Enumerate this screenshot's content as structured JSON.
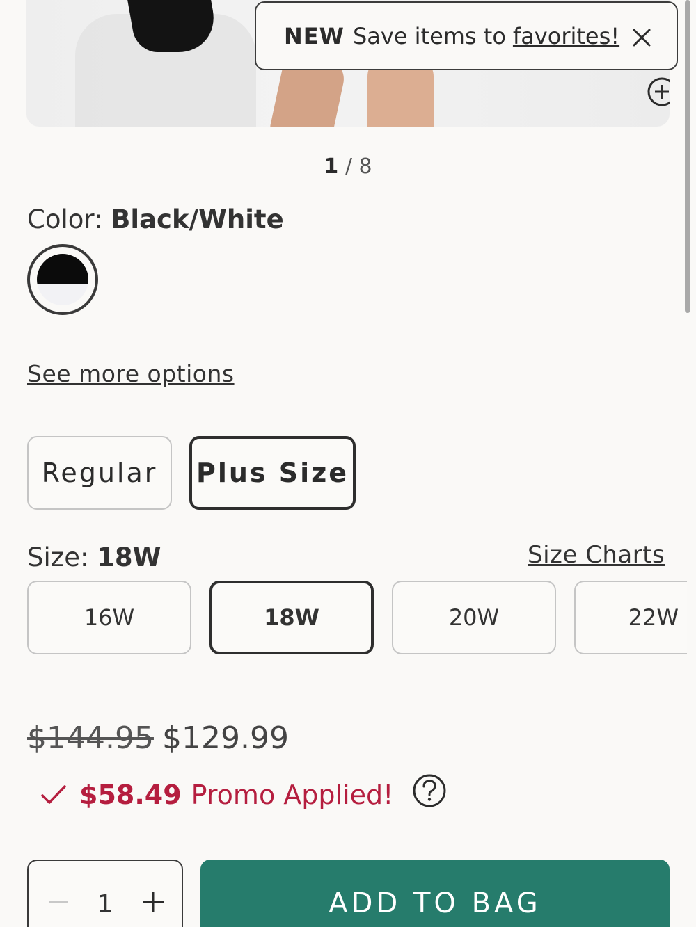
{
  "toast": {
    "new_label": "NEW",
    "message": "Save items to",
    "link": "favorites!",
    "close_icon": "close-icon"
  },
  "image_counter": {
    "current": "1",
    "separator": "/",
    "total": "8"
  },
  "color": {
    "label": "Color:",
    "value": "Black/White"
  },
  "see_more": "See more options",
  "fit": {
    "regular": "Regular",
    "plus": "Plus Size",
    "selected": "Plus Size"
  },
  "size": {
    "label": "Size:",
    "value": "18W",
    "charts_link": "Size Charts",
    "options": [
      "16W",
      "18W",
      "20W",
      "22W"
    ]
  },
  "price": {
    "original": "$144.95",
    "sale": "$129.99",
    "promo_amount": "$58.49",
    "promo_text": "Promo Applied!"
  },
  "quantity": {
    "value": "1"
  },
  "cta": {
    "add_to_bag": "ADD TO BAG"
  },
  "colors": {
    "cta": "#267c6c",
    "promo": "#b51e3f"
  }
}
